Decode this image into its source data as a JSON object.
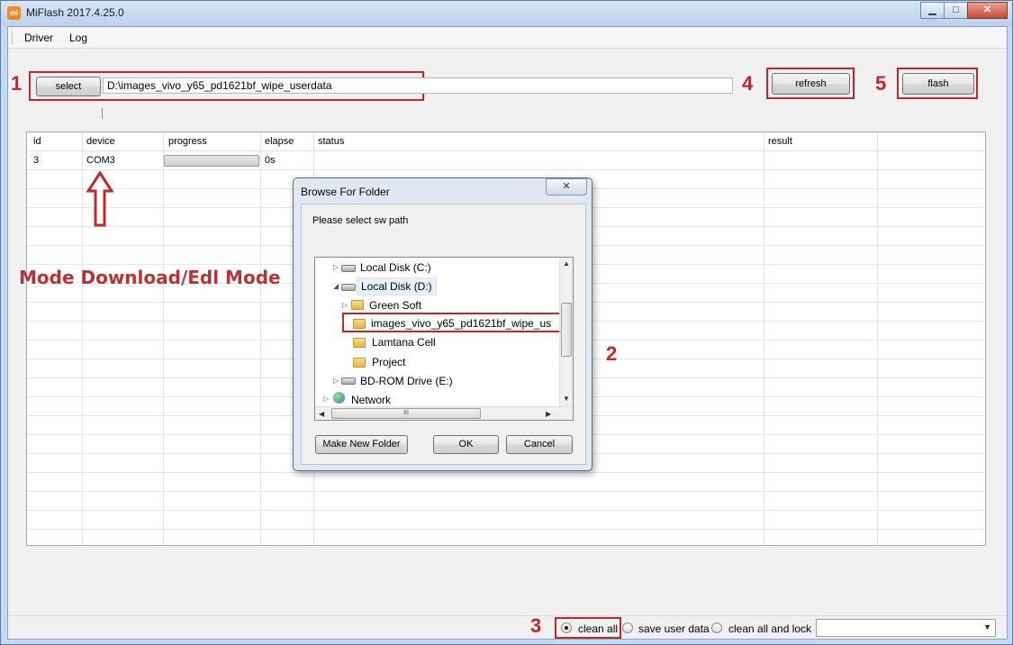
{
  "window": {
    "title": "MiFlash 2017.4.25.0",
    "icon_text": "mi",
    "minimize": "▁",
    "maximize": "□",
    "close": "✕"
  },
  "menu": {
    "items": [
      "Driver",
      "Log"
    ]
  },
  "toolbar": {
    "select_label": "select",
    "path_value": "D:\\images_vivo_y65_pd1621bf_wipe_userdata",
    "refresh_label": "refresh",
    "flash_label": "flash"
  },
  "annotations": {
    "step1": "1",
    "step2": "2",
    "step3": "3",
    "step4": "4",
    "step5": "5",
    "mode_label": "Mode Download/Edl Mode",
    "color": "#c4262b"
  },
  "grid": {
    "columns": [
      "id",
      "device",
      "progress",
      "elapse",
      "status",
      "result"
    ],
    "rows": [
      {
        "id": "3",
        "device": "COM3",
        "progress": 0,
        "elapse": "0s",
        "status": "",
        "result": ""
      }
    ]
  },
  "dialog": {
    "title": "Browse For Folder",
    "close": "✕",
    "prompt": "Please select sw path",
    "tree": [
      {
        "label": "Local Disk (C:)",
        "icon": "drive-icon"
      },
      {
        "label": "Local Disk (D:)",
        "icon": "drive-icon"
      },
      {
        "label": "Green Soft",
        "icon": "folder-icon"
      },
      {
        "label": "images_vivo_y65_pd1621bf_wipe_us",
        "icon": "folder-icon"
      },
      {
        "label": "Lamtana Cell",
        "icon": "folder-icon"
      },
      {
        "label": "Project",
        "icon": "folder-icon"
      },
      {
        "label": "BD-ROM Drive (E:)",
        "icon": "bd-drive-icon"
      },
      {
        "label": "Network",
        "icon": "network-icon"
      }
    ],
    "hscroll_grip": "III",
    "make_folder_label": "Make New Folder",
    "ok_label": "OK",
    "cancel_label": "Cancel"
  },
  "status": {
    "options": [
      "clean all",
      "save user data",
      "clean all and lock"
    ],
    "selected": "clean all",
    "combo_arrow": "▼"
  }
}
